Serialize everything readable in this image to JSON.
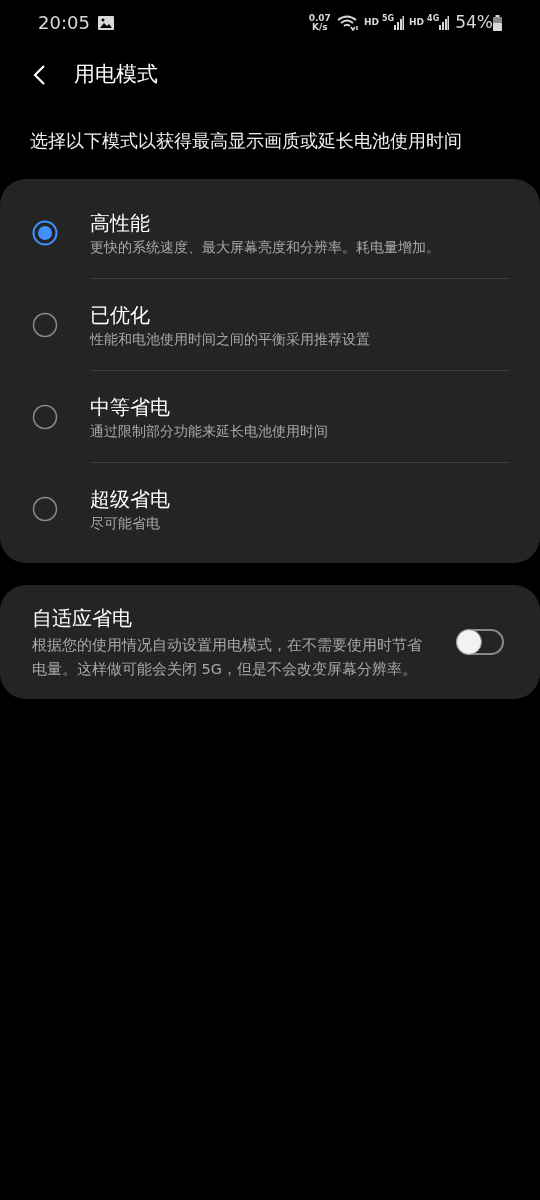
{
  "status_bar": {
    "time": "20:05",
    "net_speed": "0.07",
    "net_unit": "K/s",
    "sim1_hd": "HD",
    "sim1_network": "5G",
    "sim2_hd": "HD",
    "sim2_network": "4G",
    "battery": "54%"
  },
  "header": {
    "title": "用电模式"
  },
  "description": "选择以下模式以获得最高显示画质或延长电池使用时间",
  "modes": [
    {
      "label": "高性能",
      "detail": "更快的系统速度、最大屏幕亮度和分辨率。耗电量增加。",
      "selected": true
    },
    {
      "label": "已优化",
      "detail": "性能和电池使用时间之间的平衡采用推荐设置",
      "selected": false
    },
    {
      "label": "中等省电",
      "detail": "通过限制部分功能来延长电池使用时间",
      "selected": false
    },
    {
      "label": "超级省电",
      "detail": "尽可能省电",
      "selected": false
    }
  ],
  "adaptive": {
    "label": "自适应省电",
    "detail": "根据您的使用情况自动设置用电模式，在不需要使用时节省电量。这样做可能会关闭 5G，但是不会改变屏幕分辨率。",
    "on": false
  }
}
